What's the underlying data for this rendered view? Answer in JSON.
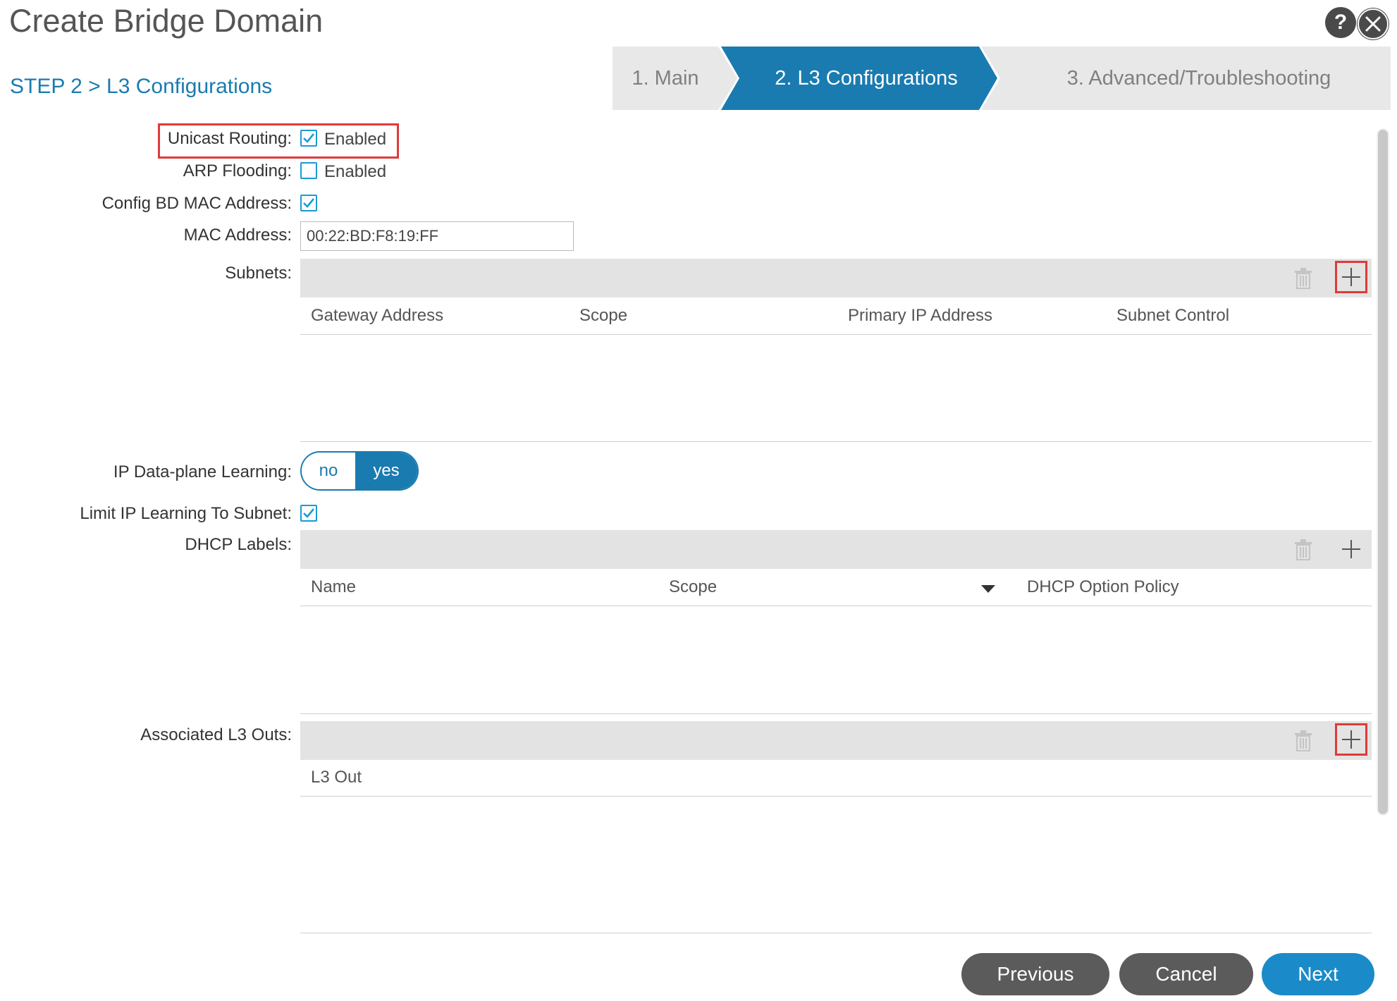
{
  "dialog": {
    "title": "Create Bridge Domain",
    "step_label": "STEP 2 > L3 Configurations"
  },
  "header_icons": {
    "help": "?",
    "close": "✕"
  },
  "wizard": {
    "steps": [
      {
        "label": "1. Main"
      },
      {
        "label": "2. L3 Configurations"
      },
      {
        "label": "3. Advanced/Troubleshooting"
      }
    ],
    "active_index": 1
  },
  "form": {
    "unicast_routing": {
      "label": "Unicast Routing:",
      "text": "Enabled",
      "checked": true
    },
    "arp_flooding": {
      "label": "ARP Flooding:",
      "text": "Enabled",
      "checked": false
    },
    "config_bd_mac": {
      "label": "Config BD MAC Address:",
      "checked": true
    },
    "mac_address": {
      "label": "MAC Address:",
      "value": "00:22:BD:F8:19:FF"
    },
    "subnets": {
      "label": "Subnets:",
      "columns": [
        "Gateway Address",
        "Scope",
        "Primary IP Address",
        "Subnet Control"
      ]
    },
    "ip_dataplane_learning": {
      "label": "IP Data-plane Learning:",
      "no": "no",
      "yes": "yes",
      "selected": "yes"
    },
    "limit_ip_learning": {
      "label": "Limit IP Learning To Subnet:",
      "checked": true
    },
    "dhcp_labels": {
      "label": "DHCP Labels:",
      "columns": [
        "Name",
        "Scope",
        "DHCP Option Policy"
      ]
    },
    "l3_outs": {
      "label": "Associated L3 Outs:",
      "columns": [
        "L3 Out"
      ]
    }
  },
  "footer": {
    "previous": "Previous",
    "cancel": "Cancel",
    "next": "Next"
  },
  "colors": {
    "accent": "#1a7bb0",
    "checkbox": "#1a9ad6",
    "highlight": "#e03a3a",
    "button_gray": "#5b5b5b",
    "button_blue": "#1a8bc8"
  }
}
